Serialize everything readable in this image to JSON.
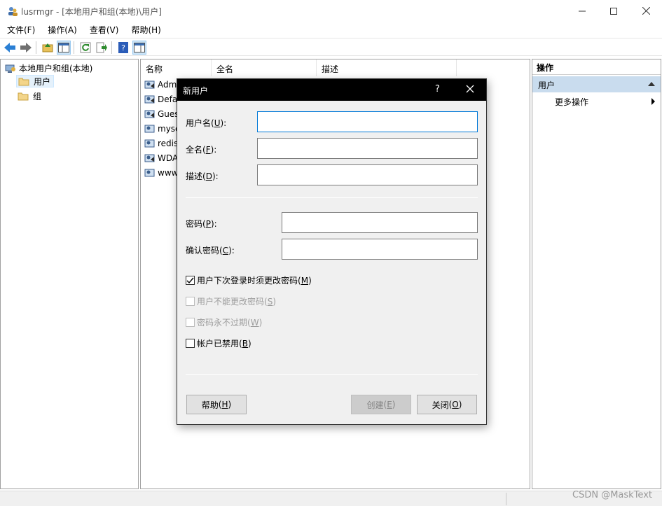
{
  "window": {
    "title": "lusrmgr - [本地用户和组(本地)\\用户]",
    "minimize": "—",
    "maximize": "☐",
    "close": "✕"
  },
  "menu": [
    "文件(F)",
    "操作(A)",
    "查看(V)",
    "帮助(H)"
  ],
  "tree": {
    "root": "本地用户和组(本地)",
    "children": [
      "用户",
      "组"
    ]
  },
  "list": {
    "columns": [
      "名称",
      "全名",
      "描述"
    ],
    "rows": [
      "Adm",
      "Defa",
      "Gues",
      "mysc",
      "redis",
      "WDA",
      "www"
    ]
  },
  "actions": {
    "title": "操作",
    "group": "用户",
    "item": "更多操作"
  },
  "dialog": {
    "title": "新用户",
    "help_glyph": "?",
    "username_label": "用户名",
    "username_key": "U",
    "fullname_label": "全名",
    "fullname_key": "F",
    "desc_label": "描述",
    "desc_key": "D",
    "password_label": "密码",
    "password_key": "P",
    "confirm_label": "确认密码",
    "confirm_key": "C",
    "username_value": "",
    "fullname_value": "",
    "desc_value": "",
    "password_value": "",
    "confirm_value": "",
    "chk_must_change": {
      "text": "用户下次登录时须更改密码",
      "key": "M",
      "checked": true
    },
    "chk_cannot_change": {
      "text": "用户不能更改密码",
      "key": "S",
      "checked": false
    },
    "chk_never_expire": {
      "text": "密码永不过期",
      "key": "W",
      "checked": false
    },
    "chk_disabled": {
      "text": "帐户已禁用",
      "key": "B",
      "checked": false
    },
    "btn_help": {
      "text": "帮助",
      "key": "H"
    },
    "btn_create": {
      "text": "创建",
      "key": "E"
    },
    "btn_close": {
      "text": "关闭",
      "key": "O"
    }
  },
  "watermark": "CSDN @MaskText"
}
